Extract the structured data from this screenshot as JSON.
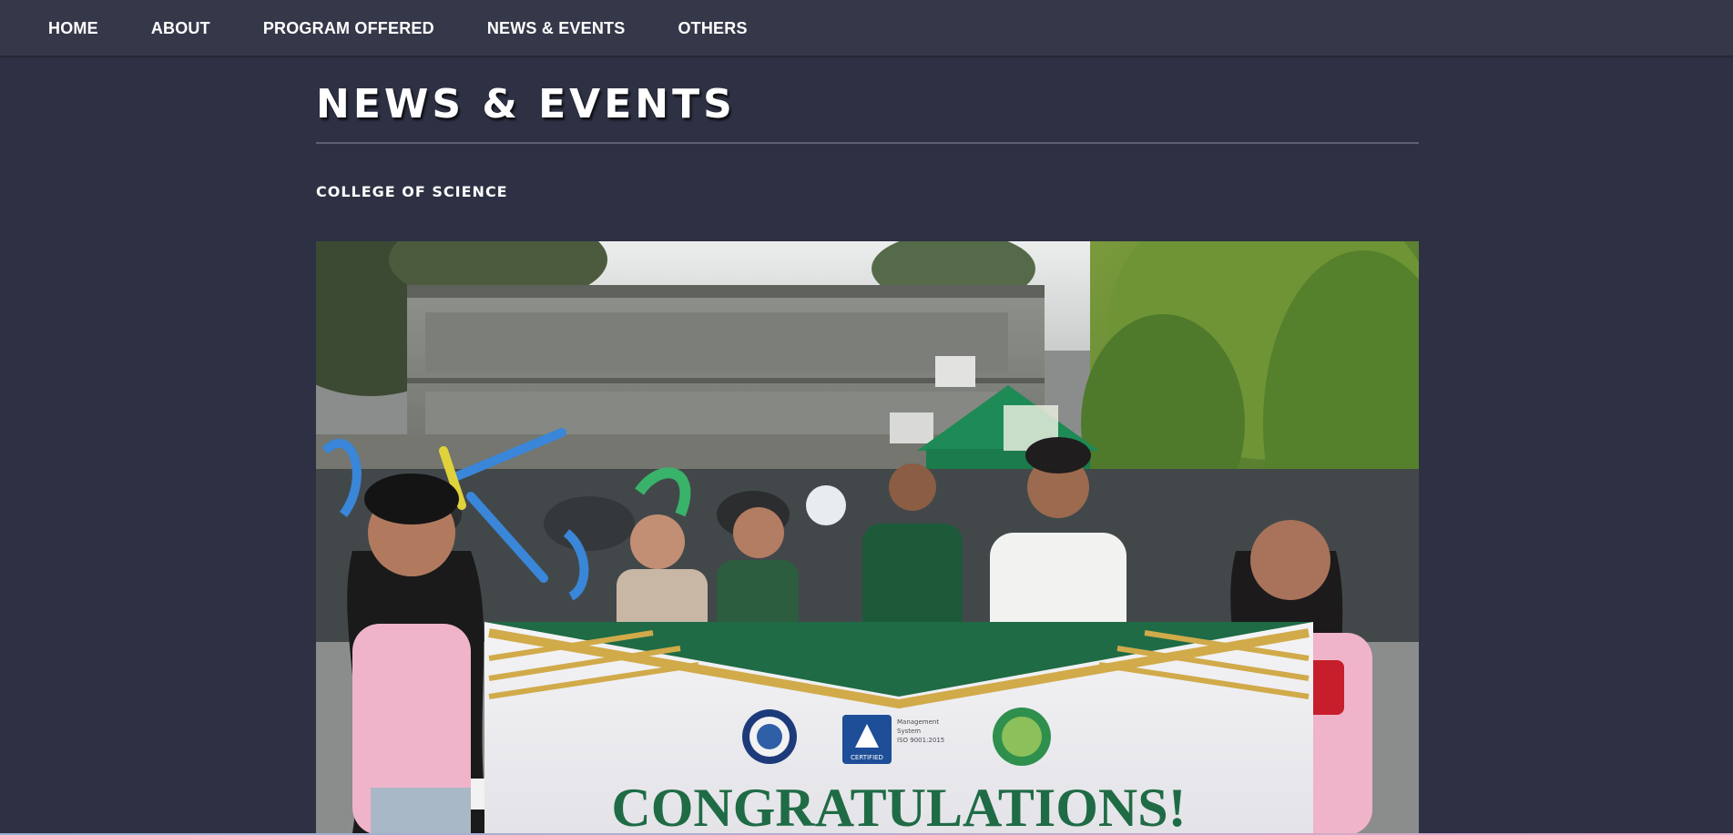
{
  "nav": {
    "items": [
      {
        "label": "HOME"
      },
      {
        "label": "ABOUT"
      },
      {
        "label": "PROGRAM OFFERED"
      },
      {
        "label": "NEWS & EVENTS"
      },
      {
        "label": "OTHERS"
      }
    ]
  },
  "page": {
    "title": "NEWS & EVENTS",
    "section": "COLLEGE OF SCIENCE"
  },
  "photo": {
    "banner_text": "CONGRATULATIONS!",
    "certificate_lines": [
      "Management",
      "System",
      "ISO 9001:2015"
    ],
    "cert_badge": "CERTIFIED"
  },
  "colors": {
    "page_bg": "#2e3143",
    "nav_bg": "#353849",
    "banner_green": "#1f6b45",
    "banner_gold": "#d1aa4a",
    "tent_green": "#1e8a55"
  }
}
